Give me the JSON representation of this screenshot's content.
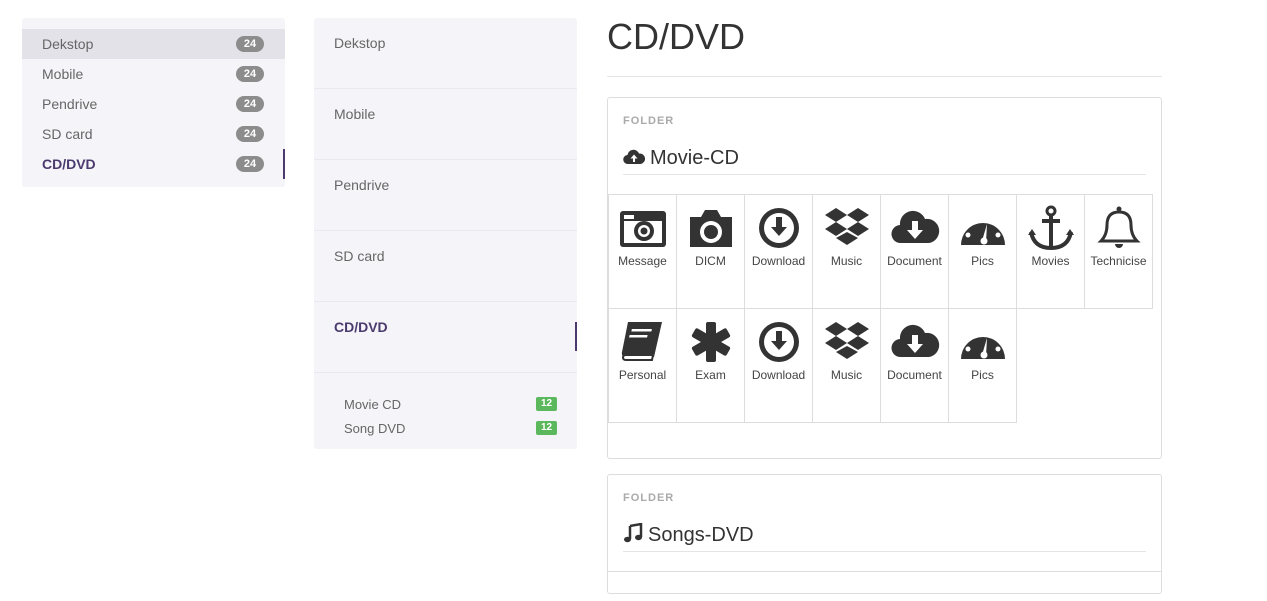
{
  "sidebar_primary": {
    "items": [
      {
        "label": "Dekstop",
        "badge": "24"
      },
      {
        "label": "Mobile",
        "badge": "24"
      },
      {
        "label": "Pendrive",
        "badge": "24"
      },
      {
        "label": "SD card",
        "badge": "24"
      },
      {
        "label": "CD/DVD",
        "badge": "24"
      }
    ],
    "active": "CD/DVD"
  },
  "sidebar_secondary": {
    "items": [
      {
        "label": "Dekstop"
      },
      {
        "label": "Mobile"
      },
      {
        "label": "Pendrive"
      },
      {
        "label": "SD card"
      },
      {
        "label": "CD/DVD"
      }
    ],
    "active": "CD/DVD",
    "subitems": [
      {
        "label": "Movie CD",
        "badge": "12"
      },
      {
        "label": "Song DVD",
        "badge": "12"
      }
    ]
  },
  "main": {
    "title": "CD/DVD",
    "panels": [
      {
        "label": "FOLDER",
        "title": "Movie-CD",
        "icon": "cloud-upload-icon",
        "tiles": [
          {
            "label": "Message",
            "icon": "camera-retro-icon"
          },
          {
            "label": "DICM",
            "icon": "camera-icon"
          },
          {
            "label": "Download",
            "icon": "download-circle-icon"
          },
          {
            "label": "Music",
            "icon": "dropbox-icon"
          },
          {
            "label": "Document",
            "icon": "cloud-download-icon"
          },
          {
            "label": "Pics",
            "icon": "dashboard-icon"
          },
          {
            "label": "Movies",
            "icon": "anchor-icon"
          },
          {
            "label": "Technicise",
            "icon": "bell-icon"
          },
          {
            "label": "Personal",
            "icon": "book-icon"
          },
          {
            "label": "Exam",
            "icon": "asterisk-icon"
          },
          {
            "label": "Download",
            "icon": "download-circle-icon"
          },
          {
            "label": "Music",
            "icon": "dropbox-icon"
          },
          {
            "label": "Document",
            "icon": "cloud-download-icon"
          },
          {
            "label": "Pics",
            "icon": "dashboard-icon"
          }
        ]
      },
      {
        "label": "FOLDER",
        "title": "Songs-DVD",
        "icon": "music-icon"
      }
    ]
  },
  "colors": {
    "accent": "#4b3a6e",
    "sidebar_bg": "#f5f4f8",
    "badge_gray": "#8c8c8c",
    "badge_green": "#5cb85c"
  }
}
